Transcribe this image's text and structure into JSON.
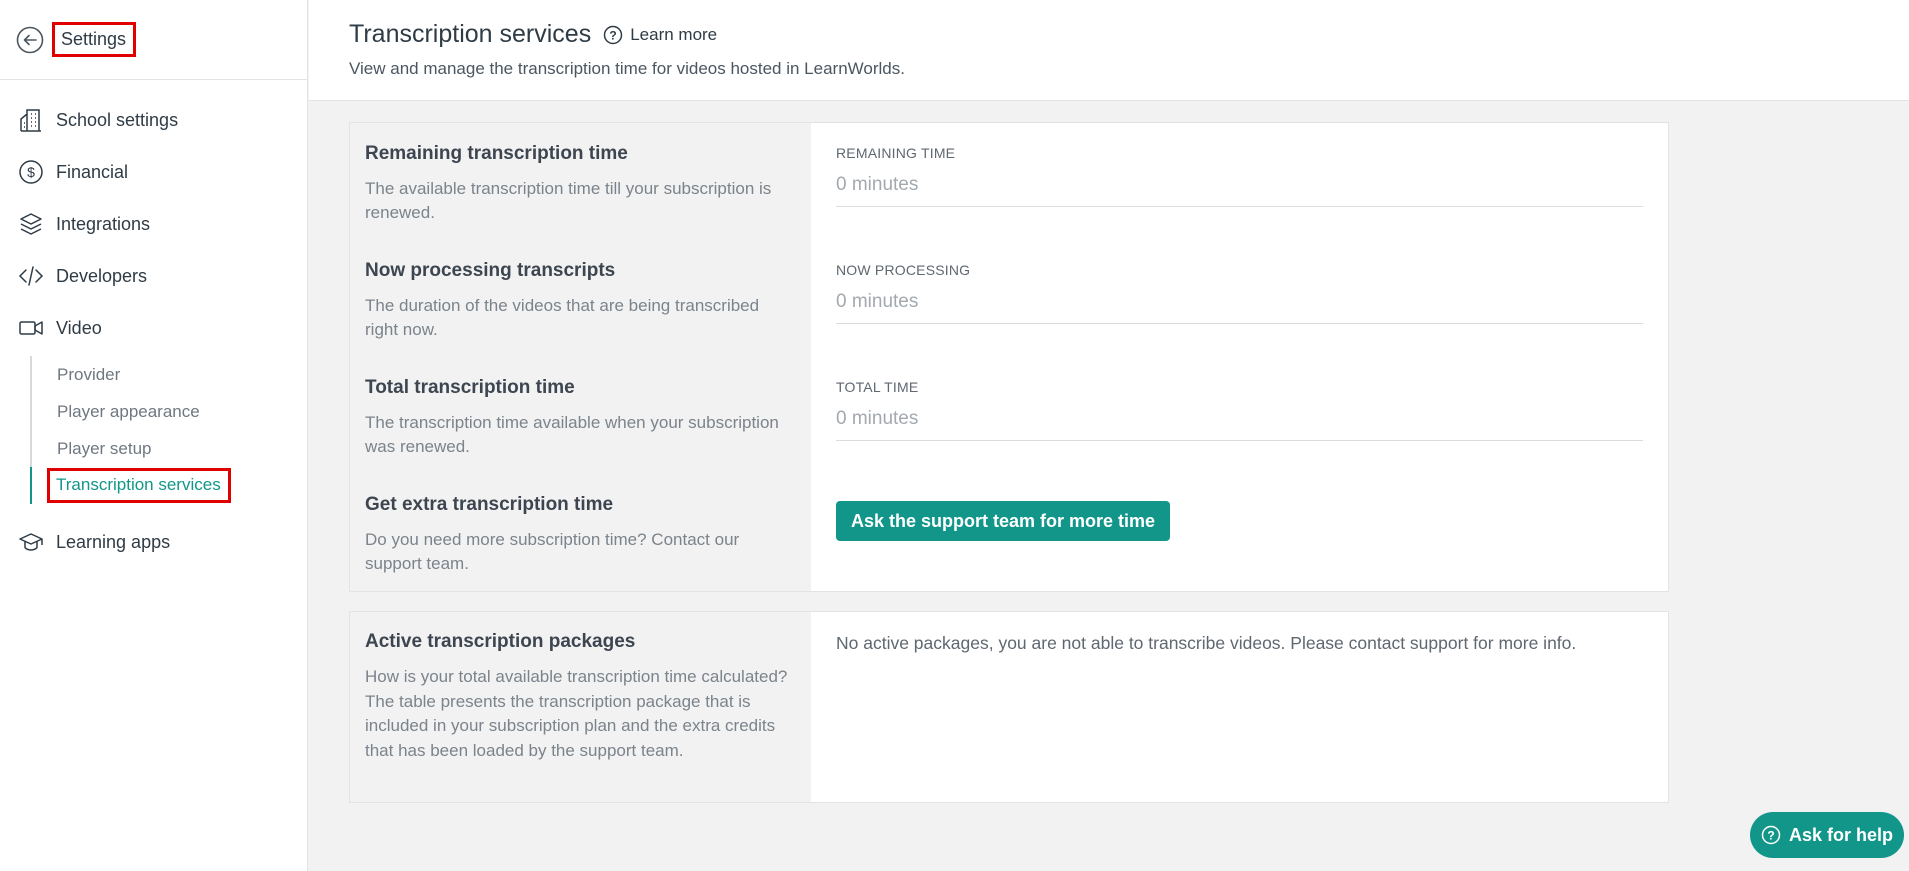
{
  "sidebar": {
    "title": "Settings",
    "items": [
      {
        "label": "School settings",
        "icon": "building-icon"
      },
      {
        "label": "Financial",
        "icon": "dollar-circle-icon"
      },
      {
        "label": "Integrations",
        "icon": "layers-icon"
      },
      {
        "label": "Developers",
        "icon": "code-icon"
      },
      {
        "label": "Video",
        "icon": "video-camera-icon"
      },
      {
        "label": "Learning apps",
        "icon": "graduation-cap-icon"
      }
    ],
    "video_subitems": [
      {
        "label": "Provider"
      },
      {
        "label": "Player appearance"
      },
      {
        "label": "Player setup"
      },
      {
        "label": "Transcription services",
        "active": true
      }
    ]
  },
  "header": {
    "title": "Transcription services",
    "learn_more": "Learn more",
    "subtitle": "View and manage the transcription time for videos hosted in LearnWorlds."
  },
  "transcription": {
    "remaining": {
      "title": "Remaining transcription time",
      "desc": "The available transcription time till your subscription is renewed.",
      "label": "REMAINING TIME",
      "value": "0 minutes"
    },
    "processing": {
      "title": "Now processing transcripts",
      "desc": "The duration of the videos that are being transcribed right now.",
      "label": "NOW PROCESSING",
      "value": "0 minutes"
    },
    "total": {
      "title": "Total transcription time",
      "desc": "The transcription time available when your subscription was renewed.",
      "label": "TOTAL TIME",
      "value": "0 minutes"
    },
    "extra": {
      "title": "Get extra transcription time",
      "desc": "Do you need more subscription time? Contact our support team.",
      "button": "Ask the support team for more time"
    }
  },
  "packages": {
    "title": "Active transcription packages",
    "desc": "How is your total available transcription time calculated? The table presents the transcription package that is included in your subscription plan and the extra credits that has been loaded by the support team.",
    "message": "No active packages, you are not able to transcribe videos. Please contact support for more info."
  },
  "help": {
    "label": "Ask for help"
  },
  "colors": {
    "accent": "#12968a",
    "highlight": "#e00000"
  }
}
